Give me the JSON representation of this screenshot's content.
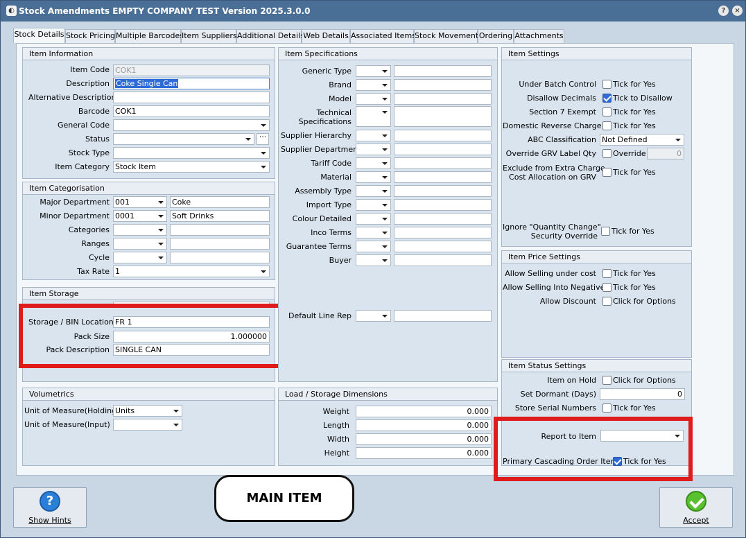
{
  "window": {
    "title": "Stock Amendments EMPTY COMPANY TEST Version 2025.3.0.0",
    "help_icon": "?",
    "close_icon": "×"
  },
  "tabs": [
    "Stock Details",
    "Stock Pricing",
    "Multiple Barcodes",
    "Item Suppliers",
    "Additional Details",
    "Web Details",
    "Associated Items",
    "Stock Movement",
    "Ordering",
    "Attachments"
  ],
  "item_information": {
    "title": "Item Information",
    "item_code": {
      "label": "Item Code",
      "value": "COK1"
    },
    "description": {
      "label": "Description",
      "value": "Coke Single Can"
    },
    "alt_description": {
      "label": "Alternative Description",
      "value": ""
    },
    "barcode": {
      "label": "Barcode",
      "value": "COK1"
    },
    "general_code": {
      "label": "General Code",
      "value": ""
    },
    "status": {
      "label": "Status",
      "value": "",
      "button": "···"
    },
    "stock_type": {
      "label": "Stock Type",
      "value": ""
    },
    "item_category": {
      "label": "Item Category",
      "value": "Stock Item"
    }
  },
  "item_categorisation": {
    "title": "Item Categorisation",
    "major_department": {
      "label": "Major Department",
      "code": "001",
      "name": "Coke"
    },
    "minor_department": {
      "label": "Minor Department",
      "code": "0001",
      "name": "Soft Drinks"
    },
    "categories": {
      "label": "Categories"
    },
    "ranges": {
      "label": "Ranges"
    },
    "cycle": {
      "label": "Cycle"
    },
    "tax_rate": {
      "label": "Tax Rate",
      "value": "1"
    }
  },
  "item_storage": {
    "title": "Item Storage",
    "storage_bin": {
      "label": "Storage / BIN Location",
      "value": "FR 1"
    },
    "pack_size": {
      "label": "Pack Size",
      "value": "1.000000"
    },
    "pack_description": {
      "label": "Pack Description",
      "value": "SINGLE CAN"
    }
  },
  "volumetrics": {
    "title": "Volumetrics",
    "uom_holding": {
      "label": "Unit of Measure(Holding)",
      "value": "Units"
    },
    "uom_input": {
      "label": "Unit of Measure(Input)",
      "value": ""
    }
  },
  "item_specifications": {
    "title": "Item Specifications",
    "rows": [
      "Generic Type",
      "Brand",
      "Model",
      "Technical Specifications",
      "Supplier Hierarchy",
      "Supplier Department",
      "Tariff Code",
      "Material",
      "Assembly Type",
      "Import Type",
      "Colour Detailed",
      "Inco Terms",
      "Guarantee Terms",
      "Buyer"
    ],
    "technical_line1": "Technical",
    "technical_line2": "Specifications",
    "default_line_rep": "Default Line Rep"
  },
  "load_storage": {
    "title": "Load / Storage Dimensions",
    "weight": {
      "label": "Weight",
      "value": "0.000"
    },
    "length": {
      "label": "Length",
      "value": "0.000"
    },
    "width": {
      "label": "Width",
      "value": "0.000"
    },
    "height": {
      "label": "Height",
      "value": "0.000"
    }
  },
  "item_settings": {
    "title": "Item Settings",
    "under_batch": {
      "label": "Under Batch Control",
      "check": "Tick for Yes",
      "checked": false
    },
    "disallow_decimals": {
      "label": "Disallow Decimals",
      "check": "Tick to Disallow",
      "checked": true
    },
    "section7": {
      "label": "Section 7 Exempt",
      "check": "Tick for Yes",
      "checked": false
    },
    "domestic_reverse": {
      "label": "Domestic Reverse Charge",
      "check": "Tick for Yes",
      "checked": false
    },
    "abc": {
      "label": "ABC Classification",
      "value": "Not Defined"
    },
    "override_grv": {
      "label": "Override GRV Label Qty",
      "check": "Override",
      "value": "0",
      "checked": false
    },
    "exclude_line1": "Exclude from Extra Charge",
    "exclude_line2": "Cost Allocation on GRV",
    "exclude_check": "Tick for Yes",
    "ignore_line1": "Ignore \"Quantity Change\"",
    "ignore_line2": "Security Override",
    "ignore_check": "Tick for Yes"
  },
  "item_price_settings": {
    "title": "Item Price Settings",
    "allow_under_cost": {
      "label": "Allow Selling under cost",
      "check": "Tick for Yes"
    },
    "allow_negative": {
      "label": "Allow Selling Into Negative",
      "check": "Tick for Yes"
    },
    "allow_discount": {
      "label": "Allow Discount",
      "check": "Click for Options"
    }
  },
  "item_status_settings": {
    "title": "Item Status Settings",
    "item_on_hold": {
      "label": "Item on Hold",
      "check": "Click for Options"
    },
    "set_dormant": {
      "label": "Set Dormant (Days)",
      "value": "0"
    },
    "serial_numbers": {
      "label": "Store Serial Numbers",
      "check": "Tick for Yes"
    },
    "report_to_item": {
      "label": "Report to Item",
      "value": ""
    },
    "primary_cascading": {
      "label": "Primary Cascading Order Item",
      "check": "Tick for Yes",
      "checked": true
    }
  },
  "annotation": {
    "text": "MAIN ITEM",
    "highlight_color": "#e01b1b"
  },
  "footer": {
    "show_hints": "Show Hints",
    "accept": "Accept"
  }
}
